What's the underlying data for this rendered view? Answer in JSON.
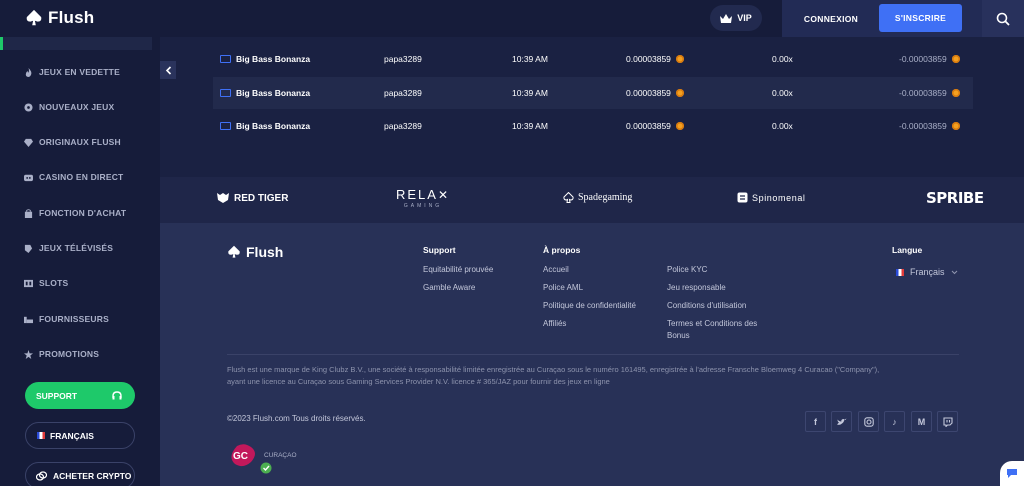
{
  "header": {
    "brand": "Flush",
    "vip_label": "VIP",
    "login_label": "CONNEXION",
    "signup_label": "S'INSCRIRE"
  },
  "sidebar": {
    "items": [
      {
        "label": "JEUX EN VEDETTE",
        "icon": "fire-icon"
      },
      {
        "label": "NOUVEAUX JEUX",
        "icon": "new-badge-icon"
      },
      {
        "label": "ORIGINAUX FLUSH",
        "icon": "diamond-icon"
      },
      {
        "label": "CASINO EN DIRECT",
        "icon": "live-dealer-icon"
      },
      {
        "label": "FONCTION D'ACHAT",
        "icon": "shopping-bag-icon"
      },
      {
        "label": "JEUX TÉLÉVISÉS",
        "icon": "tv-icon"
      },
      {
        "label": "SLOTS",
        "icon": "slot-machine-icon"
      },
      {
        "label": "FOURNISSEURS",
        "icon": "providers-icon"
      },
      {
        "label": "PROMOTIONS",
        "icon": "star-icon"
      }
    ],
    "support_label": "SUPPORT",
    "language_label": "FRANÇAIS",
    "crypto_label": "ACHETER CRYPTO"
  },
  "bets": {
    "rows": [
      {
        "game": "Big Bass Bonanza",
        "user": "papa3289",
        "time": "10:39 AM",
        "amount": "0.00003859",
        "multiplier": "0.00x",
        "payout": "-0.00003859"
      },
      {
        "game": "Big Bass Bonanza",
        "user": "papa3289",
        "time": "10:39 AM",
        "amount": "0.00003859",
        "multiplier": "0.00x",
        "payout": "-0.00003859"
      },
      {
        "game": "Big Bass Bonanza",
        "user": "papa3289",
        "time": "10:39 AM",
        "amount": "0.00003859",
        "multiplier": "0.00x",
        "payout": "-0.00003859"
      }
    ]
  },
  "providers": {
    "red_tiger": "RED TIGER",
    "relax": "RELA",
    "relax_sub": "GAMING",
    "spadegaming": "Spadegaming",
    "spinomenal": "Spinomenal",
    "spribe": "SPRIBE"
  },
  "footer": {
    "brand": "Flush",
    "support": {
      "heading": "Support",
      "links": [
        "Equitabilité prouvée",
        "Gamble Aware"
      ]
    },
    "about": {
      "heading": "À propos",
      "col1": [
        "Accueil",
        "Police AML",
        "Politique de confidentialité",
        "Affiliés"
      ],
      "col2": [
        "Police KYC",
        "Jeu responsable",
        "Conditions d'utilisation",
        "Termes et Conditions des",
        "Bonus"
      ]
    },
    "language": {
      "heading": "Langue",
      "value": "Français"
    },
    "legal_line1": "Flush est une marque de King Clubz B.V., une société à responsabilité limitée enregistrée au Curaçao sous le numéro 161495, enregistrée à l'adresse Fransche Bloemweg 4 Curacao (\"Company\"),",
    "legal_line2": "ayant une licence au Curaçao sous Gaming Services Provider N.V. licence # 365/JAZ pour fournir des jeux en ligne",
    "copyright": "©2023 Flush.com Tous droits réservés.",
    "social": [
      "f",
      "t",
      "◎",
      "♪",
      "M",
      "▭"
    ],
    "seal_text": "CURAÇAO"
  },
  "colors": {
    "accent_blue": "#3f70f5",
    "accent_green": "#1ec96a",
    "coin": "#f4a020",
    "background": "#1a2142"
  }
}
